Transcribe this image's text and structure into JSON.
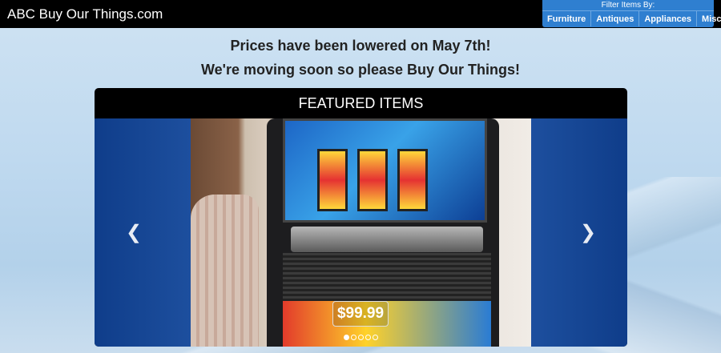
{
  "header": {
    "brand": "ABC Buy Our Things.com"
  },
  "filter": {
    "title": "Filter Items By:",
    "options": [
      "Furniture",
      "Antiques",
      "Appliances",
      "Misc"
    ]
  },
  "announcements": {
    "line1": "Prices have been lowered on May 7th!",
    "line2": "We're moving soon so please Buy Our Things!"
  },
  "featured": {
    "title": "FEATURED ITEMS",
    "current_price": "$99.99",
    "prev_icon": "chevron-left-icon",
    "next_icon": "chevron-right-icon",
    "slide_count": 5,
    "active_slide": 0
  },
  "colors": {
    "topbar": "#000000",
    "filter_bg": "#2f7fd0",
    "featured_bg": "#000000"
  }
}
